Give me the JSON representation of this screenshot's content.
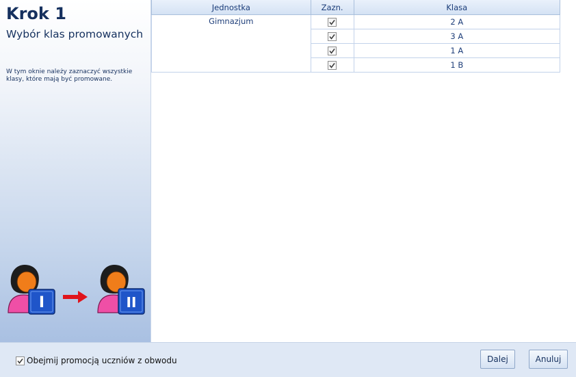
{
  "sidebar": {
    "step_title": "Krok 1",
    "step_subtitle": "Wybór klas promowanych",
    "description": "W tym oknie należy zaznaczyć wszystkie klasy, które mają być promowane.",
    "illustration_badges": [
      "I",
      "II"
    ]
  },
  "table": {
    "headers": {
      "unit": "Jednostka",
      "selected": "Zazn.",
      "class": "Klasa"
    },
    "unit_name": "Gimnazjum",
    "rows": [
      {
        "selected": true,
        "class_name": "2 A"
      },
      {
        "selected": true,
        "class_name": "3 A"
      },
      {
        "selected": true,
        "class_name": "1 A"
      },
      {
        "selected": true,
        "class_name": "1 B"
      }
    ]
  },
  "footer": {
    "include_district_checked": true,
    "include_district_label": "Obejmij promocją uczniów z obwodu",
    "next_label": "Dalej",
    "cancel_label": "Anuluj"
  },
  "colors": {
    "title": "#15305e",
    "grid_text": "#1f3f7a",
    "arrow": "#e0141b",
    "badge": "#1f55c9"
  }
}
